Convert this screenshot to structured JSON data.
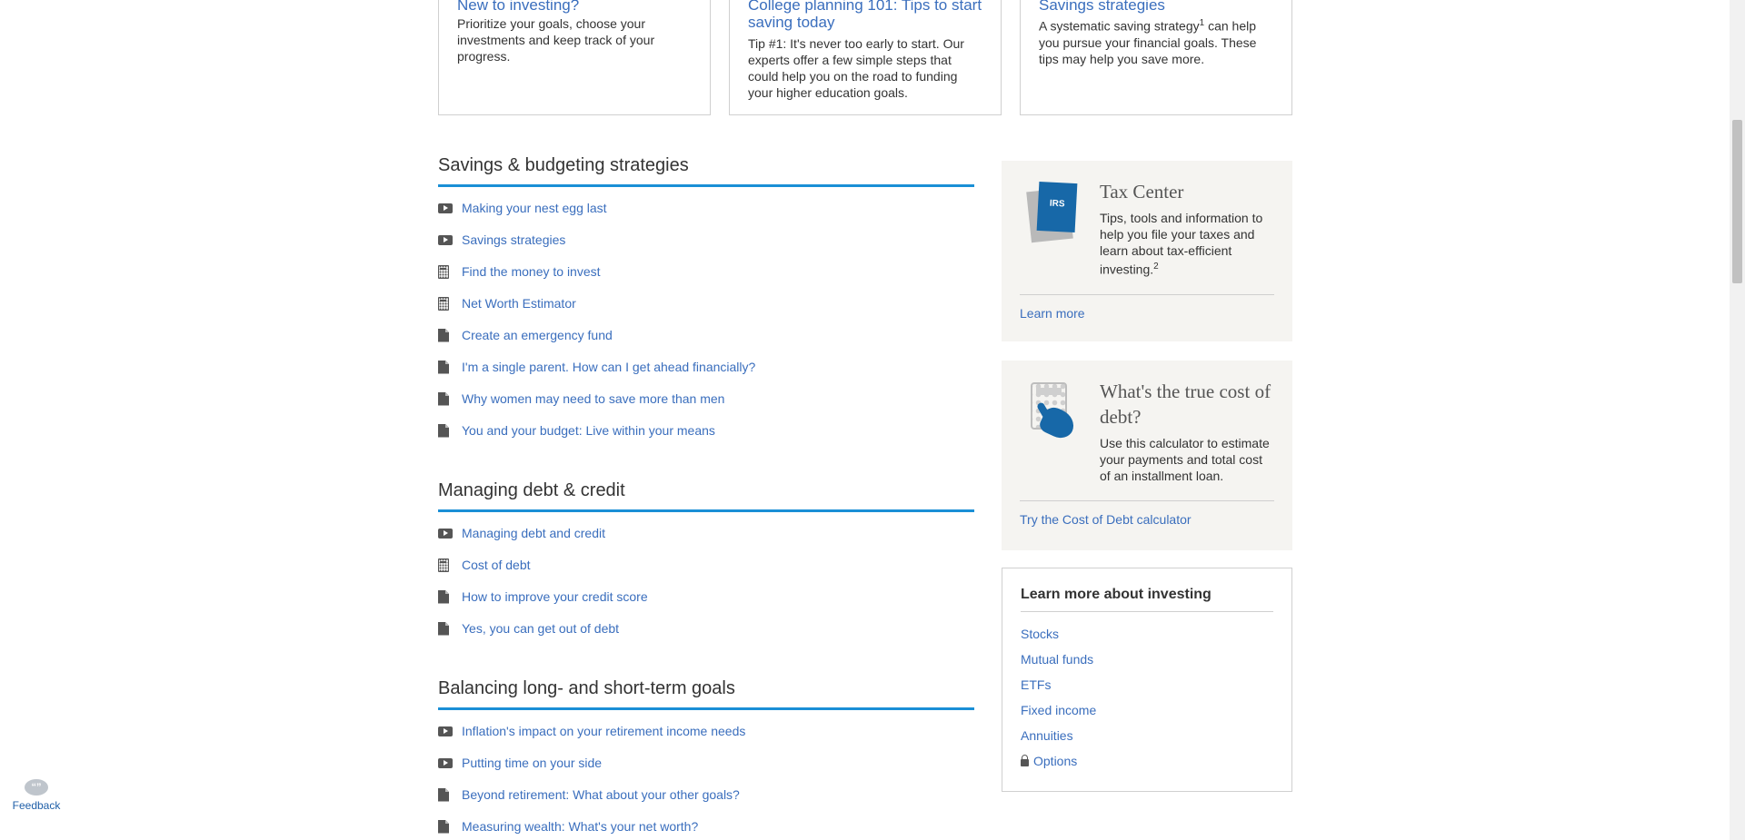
{
  "top_cards": [
    {
      "title": "New to investing?",
      "text": "Prioritize your goals, choose your investments and keep track of your progress."
    },
    {
      "title": "College planning 101: Tips to start saving today",
      "text": "Tip #1: It's never too early to start. Our experts offer a few simple steps that could help you on the road to funding your higher education goals."
    },
    {
      "title": "Savings strategies",
      "text_before": "A systematic saving strategy",
      "sup": "1",
      "text_after": " can help you pursue your financial goals. These tips may help you save more."
    }
  ],
  "sections": [
    {
      "title": "Savings & budgeting strategies",
      "items": [
        {
          "icon": "video-icon",
          "label": "Making your nest egg last"
        },
        {
          "icon": "video-icon",
          "label": "Savings strategies"
        },
        {
          "icon": "calculator-icon",
          "label": "Find the money to invest"
        },
        {
          "icon": "calculator-icon",
          "label": "Net Worth Estimator"
        },
        {
          "icon": "document-icon",
          "label": "Create an emergency fund"
        },
        {
          "icon": "document-icon",
          "label": "I'm a single parent. How can I get ahead financially?"
        },
        {
          "icon": "document-icon",
          "label": "Why women may need to save more than men"
        },
        {
          "icon": "document-icon",
          "label": "You and your budget: Live within your means"
        }
      ]
    },
    {
      "title": "Managing debt & credit",
      "items": [
        {
          "icon": "video-icon",
          "label": "Managing debt and credit"
        },
        {
          "icon": "calculator-icon",
          "label": "Cost of debt"
        },
        {
          "icon": "document-icon",
          "label": "How to improve your credit score"
        },
        {
          "icon": "document-icon",
          "label": "Yes, you can get out of debt"
        }
      ]
    },
    {
      "title": "Balancing long- and short-term goals",
      "items": [
        {
          "icon": "video-icon",
          "label": "Inflation's impact on your retirement income needs"
        },
        {
          "icon": "video-icon",
          "label": "Putting time on your side"
        },
        {
          "icon": "document-icon",
          "label": "Beyond retirement: What about your other goals?"
        },
        {
          "icon": "document-icon",
          "label": "Measuring wealth: What's your net worth?"
        }
      ]
    }
  ],
  "tax_center": {
    "icon_label": "IRS",
    "title": "Tax Center",
    "text": "Tips, tools and information to help you file your taxes and learn about tax-efficient investing.",
    "sup": "2",
    "link": "Learn more"
  },
  "cost_of_debt": {
    "title": "What's the true cost of debt?",
    "text": "Use this calculator to estimate your payments and total cost of an installment loan.",
    "link": "Try the Cost of Debt calculator"
  },
  "learn_more": {
    "title": "Learn more about investing",
    "links": [
      "Stocks",
      "Mutual funds",
      "ETFs",
      "Fixed income",
      "Annuities",
      "Options"
    ]
  },
  "feedback": {
    "label": "Feedback"
  }
}
